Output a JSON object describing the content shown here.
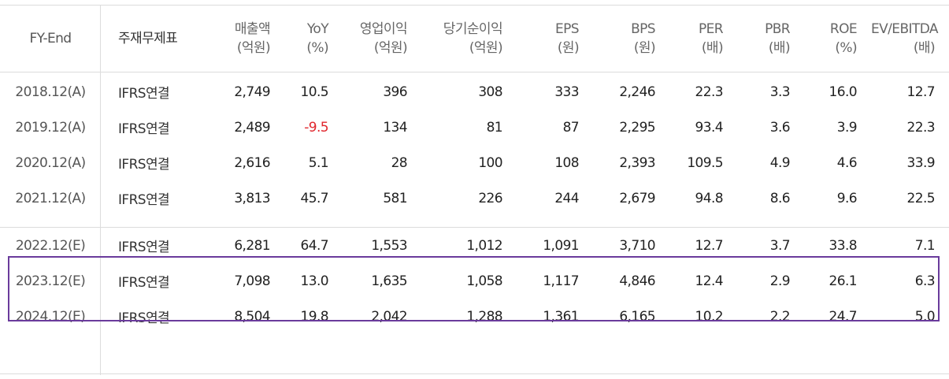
{
  "table": {
    "headers": [
      {
        "label": "FY-End",
        "unit": ""
      },
      {
        "label": "주재무제표",
        "unit": ""
      },
      {
        "label": "매출액",
        "unit": "(억원)"
      },
      {
        "label": "YoY",
        "unit": "(%)"
      },
      {
        "label": "영업이익",
        "unit": "(억원)"
      },
      {
        "label": "당기순이익",
        "unit": "(억원)"
      },
      {
        "label": "EPS",
        "unit": "(원)"
      },
      {
        "label": "BPS",
        "unit": "(원)"
      },
      {
        "label": "PER",
        "unit": "(배)"
      },
      {
        "label": "PBR",
        "unit": "(배)"
      },
      {
        "label": "ROE",
        "unit": "(%)"
      },
      {
        "label": "EV/EBITDA",
        "unit": "(배)"
      }
    ],
    "actual_rows": [
      [
        "2018.12(A)",
        "IFRS연결",
        "2,749",
        "10.5",
        "396",
        "308",
        "333",
        "2,246",
        "22.3",
        "3.3",
        "16.0",
        "12.7"
      ],
      [
        "2019.12(A)",
        "IFRS연결",
        "2,489",
        "-9.5",
        "134",
        "81",
        "87",
        "2,295",
        "93.4",
        "3.6",
        "3.9",
        "22.3"
      ],
      [
        "2020.12(A)",
        "IFRS연결",
        "2,616",
        "5.1",
        "28",
        "100",
        "108",
        "2,393",
        "109.5",
        "4.9",
        "4.6",
        "33.9"
      ],
      [
        "2021.12(A)",
        "IFRS연결",
        "3,813",
        "45.7",
        "581",
        "226",
        "244",
        "2,679",
        "94.8",
        "8.6",
        "9.6",
        "22.5"
      ]
    ],
    "estimate_rows": [
      [
        "2022.12(E)",
        "IFRS연결",
        "6,281",
        "64.7",
        "1,553",
        "1,012",
        "1,091",
        "3,710",
        "12.7",
        "3.7",
        "33.8",
        "7.1"
      ],
      [
        "2023.12(E)",
        "IFRS연결",
        "7,098",
        "13.0",
        "1,635",
        "1,058",
        "1,117",
        "4,846",
        "12.4",
        "2.9",
        "26.1",
        "6.3"
      ],
      [
        "2024.12(E)",
        "IFRS연결",
        "8,504",
        "19.8",
        "2,042",
        "1,288",
        "1,361",
        "6,165",
        "10.2",
        "2.2",
        "24.7",
        "5.0"
      ]
    ]
  },
  "colors": {
    "negative": "#e0262d",
    "highlight_border": "#6a3b9c",
    "grid_line": "#dcdcdc"
  }
}
